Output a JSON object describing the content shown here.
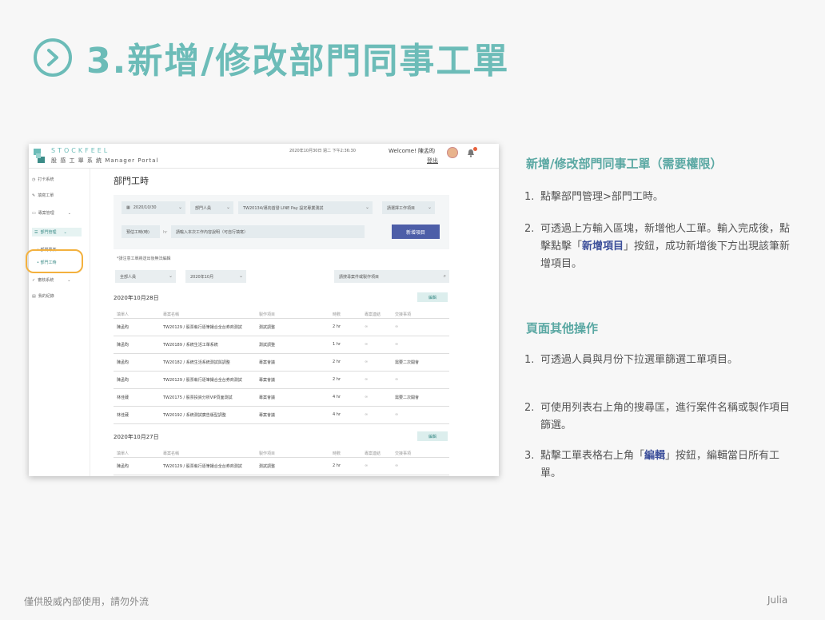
{
  "slide": {
    "title": "3.新增/修改部門同事工單",
    "footer_left": "僅供股威內部使用，請勿外流",
    "footer_right": "Julia"
  },
  "app": {
    "brand": "STOCKFEEL",
    "subtitle": "股 感 工 單 系 統   Manager Portal",
    "date": "2020年10月30日   週二 下午2:36:30",
    "welcome": "Welcome! 陳孟昀",
    "logout": "登出",
    "sidebar": [
      {
        "label": "打卡系統",
        "icon": "clock-icon"
      },
      {
        "label": "填寫工單",
        "icon": "pencil-icon"
      },
      {
        "label": "專案管理",
        "icon": "folder-icon"
      },
      {
        "label": "部門管理",
        "icon": "list-icon"
      },
      {
        "label": "審核系統",
        "icon": "check-icon"
      },
      {
        "label": "我的紀錄",
        "icon": "record-icon"
      }
    ],
    "sidebar_sub": [
      "部門專案",
      "部門工時"
    ],
    "page_title": "部門工時",
    "form": {
      "date": "2020/10/30",
      "member": "部門人員",
      "project": "TW20134/邁向首發 LINE Pay 設定專業測試",
      "category": "請選擇工作項目",
      "hours": "預估工時(時)",
      "hours_unit": "hr",
      "note_placeholder": "請輸入本次工作內容說明（可自行填寫）",
      "add_button": "新增項目"
    },
    "form_note": "*請注意工單將送出後無法編輯",
    "filter": {
      "person": "全部人員",
      "month": "2020年10月",
      "search_placeholder": "請搜尋案件或製作項目"
    },
    "edit_label": "編輯",
    "headers": [
      "填單人",
      "專案名稱",
      "製作項目",
      "時數",
      "專案連結",
      "交接事項"
    ],
    "day1": {
      "label": "2020年10月28日",
      "rows": [
        [
          "陳孟昀",
          "TW20129 / 股票執行逐筆撮合全台券商測試",
          "測試調整",
          "2 hr",
          "",
          ""
        ],
        [
          "陳孟昀",
          "TW20189 / 系統生活工單系統",
          "測試調整",
          "1 hr",
          "",
          ""
        ],
        [
          "陳孟昀",
          "TW20182 / 系統生活系統測試與調整",
          "專案會議",
          "2 hr",
          "",
          "需要二次開會"
        ],
        [
          "陳孟昀",
          "TW20129 / 股票執行逐筆撮合全台券商測試",
          "專案會議",
          "2 hr",
          "",
          ""
        ],
        [
          "林佳葳",
          "TW20175 / 股票投資分析VIP頁面測試",
          "專案會議",
          "4 hr",
          "",
          "需要二次開會"
        ],
        [
          "林佳葳",
          "TW20192 / 系統測試廣告版型調整",
          "專案會議",
          "4 hr",
          "",
          ""
        ]
      ]
    },
    "day2": {
      "label": "2020年10月27日",
      "rows": [
        [
          "陳孟昀",
          "TW20129 / 股票執行逐筆撮合全台券商測試",
          "測試調整",
          "2 hr",
          "",
          ""
        ]
      ]
    }
  },
  "right": {
    "section1_title": "新增/修改部門同事工單（需要權限）",
    "s1_1_num": "1.",
    "s1_1": "點擊部門管理>部門工時。",
    "s1_2_num": "2.",
    "s1_2a": "可透過上方輸入區塊，新增他人工單。輸入完成後，點擊點擊「",
    "s1_2b": "新增項目",
    "s1_2c": "」按鈕，成功新增後下方出現該筆新增項目。",
    "section2_title": "頁面其他操作",
    "s2_1_num": "1.",
    "s2_1": "可透過人員與月份下拉選單篩選工單項目。",
    "s2_2_num": "2.",
    "s2_2": "可使用列表右上角的搜尋匡，進行案件名稱或製作項目篩選。",
    "s2_3_num": "3.",
    "s2_3a": "點擊工單表格右上角「",
    "s2_3b": "編輯",
    "s2_3c": "」按鈕，編輯當日所有工單。"
  }
}
